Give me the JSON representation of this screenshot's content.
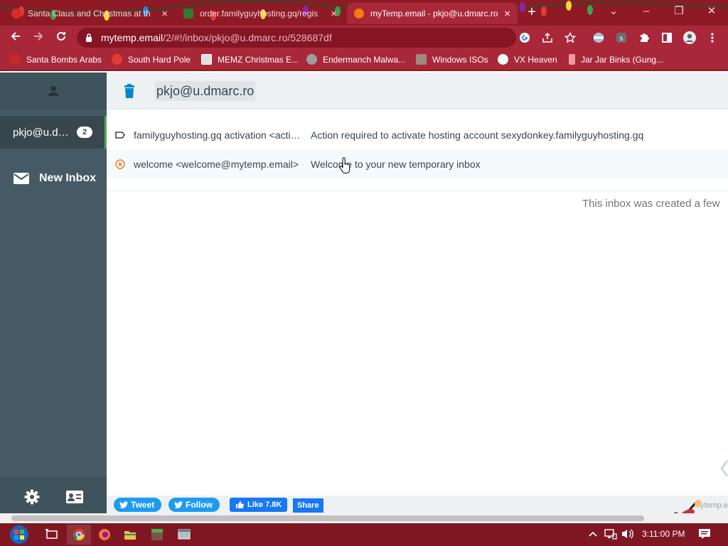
{
  "browser": {
    "tabs": [
      {
        "title": "Santa Claus and Christmas at th",
        "close": "×",
        "favicon_color": "#d62b2b"
      },
      {
        "title": "order.familyguyhosting.gq/regis",
        "close": "×",
        "favicon_color": "#2e7d32"
      },
      {
        "title": "myTemp.email - pkjo@u.dmarc.ro",
        "close": "×",
        "favicon_color": "#f57c00"
      }
    ],
    "new_tab": "+",
    "window_controls": [
      "⌄",
      "–",
      "❐",
      "✕"
    ],
    "url": {
      "host": "mytemp.email",
      "path": "/2/#!/inbox/pkjo@u.dmarc.ro/528687df"
    },
    "bookmarks": [
      {
        "label": "Santa Bombs Arabs",
        "icon": "santa-icon"
      },
      {
        "label": "South Hard Pole",
        "icon": "snowflake-icon"
      },
      {
        "label": "MEMZ Christmas E...",
        "icon": "window-icon"
      },
      {
        "label": "Endermanch Malwa...",
        "icon": "raccoon-icon"
      },
      {
        "label": "Windows ISOs",
        "icon": "figure-icon"
      },
      {
        "label": "VX Heaven",
        "icon": "skull-icon"
      },
      {
        "label": "Jar Jar Binks (Gung...",
        "icon": "figure-icon"
      }
    ]
  },
  "sidebar": {
    "account": {
      "address": "pkjo@u.dmarc.ro",
      "count": "2"
    },
    "new_inbox": "New Inbox"
  },
  "inbox": {
    "address": "pkjo@u.dmarc.ro",
    "messages": [
      {
        "from": "familyguyhosting.gq activation <activation@familyguyhosting.gq>",
        "subject": "Action required to activate hosting account sexydonkey.familyguyhosting.gq",
        "icon": "label-icon"
      },
      {
        "from": "welcome <welcome@mytemp.email>",
        "subject": "Welcome to your new temporary inbox",
        "icon": "cancel-circle-icon"
      }
    ],
    "created_note": "This inbox was created a few"
  },
  "social": {
    "tweet": "Tweet",
    "follow": "Follow",
    "like": "Like 7.8K",
    "share": "Share",
    "footer_mark": "mytemp.e"
  },
  "taskbar": {
    "clock": "3:11:00 PM"
  },
  "colors": {
    "chrome_dark": "#8e1a26",
    "chrome": "#a8283a",
    "sidebar": "#455a64",
    "sidebar_active": "#37474f",
    "accent_green": "#4caf50",
    "delete_blue": "#0288d1",
    "twitter": "#1d9bf0",
    "facebook": "#1877f2"
  }
}
